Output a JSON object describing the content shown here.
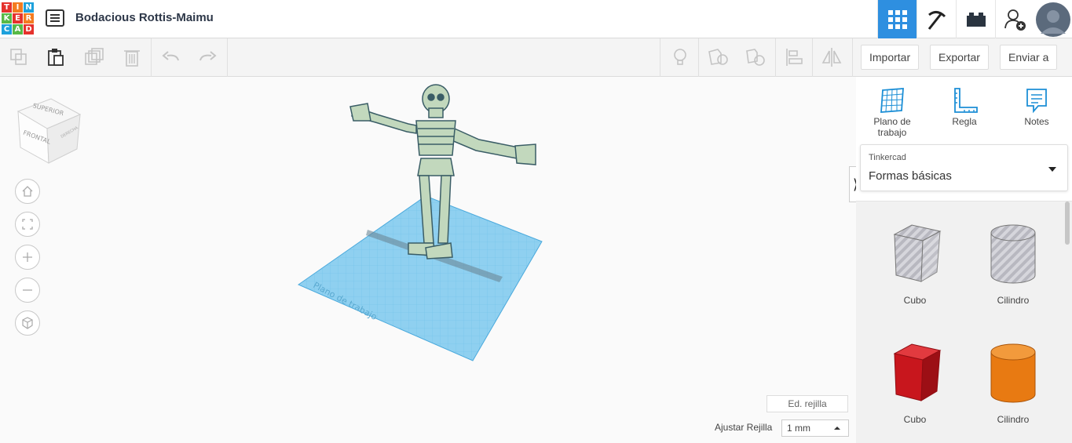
{
  "app": {
    "logo_letters": [
      "TIN",
      "KER",
      "CAD"
    ],
    "title": "Bodacious Rottis-Maimu"
  },
  "top_icons": [
    {
      "name": "grid-view-icon",
      "active": true
    },
    {
      "name": "pickaxe-icon",
      "active": false
    },
    {
      "name": "bricks-icon",
      "active": false
    },
    {
      "name": "add-user-icon",
      "active": false
    }
  ],
  "toolbar": {
    "import_label": "Importar",
    "export_label": "Exportar",
    "send_label": "Enviar a"
  },
  "viewcube": {
    "top": "SUPERIOR",
    "front": "FRONTAL",
    "right": "DERECHA"
  },
  "workspace": {
    "plane_label": "Plano de trabajo",
    "grid_edit_label": "Ed. rejilla",
    "snap_label": "Ajustar Rejilla",
    "snap_value": "1 mm"
  },
  "panel": {
    "workplane_label": "Plano de trabajo",
    "ruler_label": "Regla",
    "notes_label": "Notes",
    "library_source": "Tinkercad",
    "library_name": "Formas básicas",
    "shapes": [
      {
        "label": "Cubo",
        "kind": "cube",
        "color": "#b8b8c0",
        "striped": true
      },
      {
        "label": "Cilindro",
        "kind": "cylinder",
        "color": "#b8b8c0",
        "striped": true
      },
      {
        "label": "Cubo",
        "kind": "cube",
        "color": "#c8161d",
        "striped": false
      },
      {
        "label": "Cilindro",
        "kind": "cylinder",
        "color": "#e87a12",
        "striped": false
      }
    ]
  },
  "colors": {
    "accent": "#2e8fe0",
    "plane": "#8fd0f0",
    "model": "#c2d8bd"
  }
}
